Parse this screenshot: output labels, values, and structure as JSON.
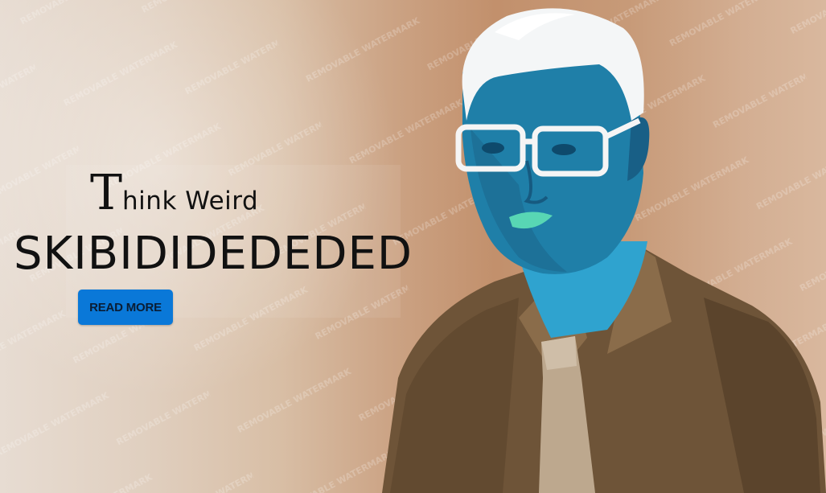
{
  "hero": {
    "headline_first_letter": "T",
    "headline_rest": "hink Weird",
    "headline_main": "SKIBIDIDEDEDED",
    "cta_label": "READ MORE"
  },
  "watermark": {
    "text": "REMOVABLE WATERMARK"
  },
  "colors": {
    "background_light": "#e7dcd2",
    "background_warm": "#c2906c",
    "button": "#0a78d8",
    "skin_inverted": "#1f7fa8",
    "shirt": "#6e5438",
    "glasses": "#f5f5f5",
    "lips": "#58d6b4"
  },
  "icons": {
    "person": "inverted-man-portrait"
  }
}
